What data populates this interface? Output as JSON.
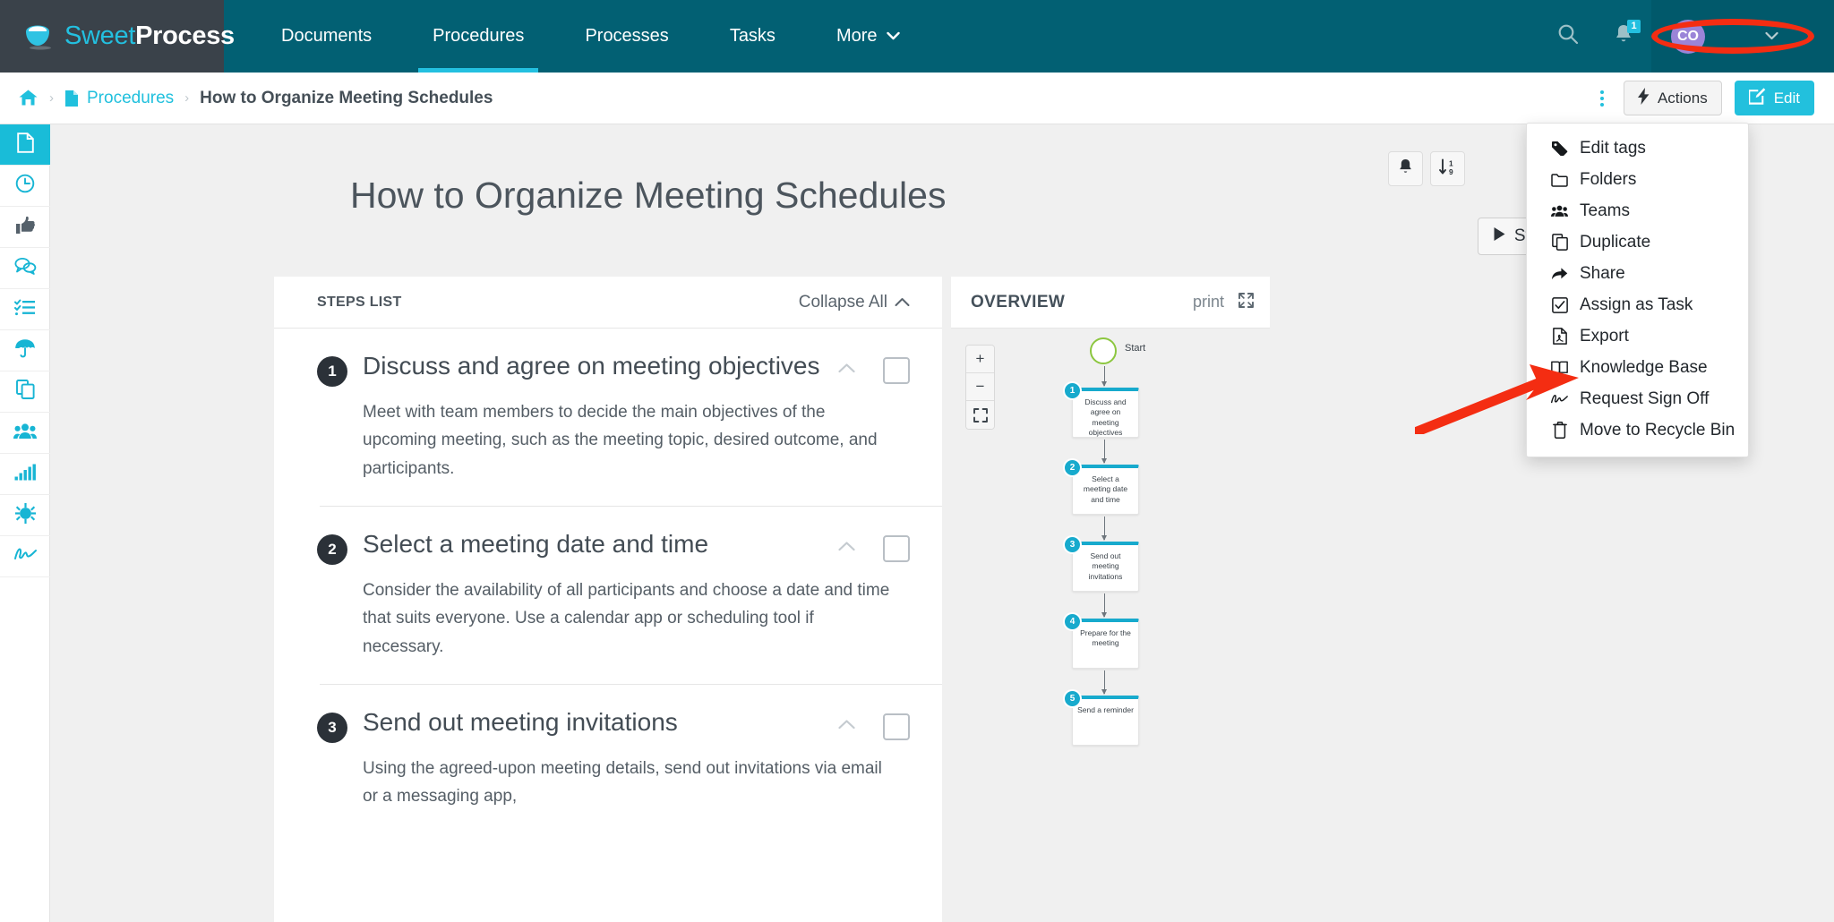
{
  "brand": {
    "name_part1": "Sweet",
    "name_part2": "Process",
    "logo_icon": "coffee-cup-icon"
  },
  "topnav": {
    "items": [
      {
        "label": "Documents",
        "active": false
      },
      {
        "label": "Procedures",
        "active": true
      },
      {
        "label": "Processes",
        "active": false
      },
      {
        "label": "Tasks",
        "active": false
      },
      {
        "label": "More",
        "active": false,
        "caret": "⌄"
      }
    ],
    "search_icon": "search-icon",
    "bell_icon": "bell-icon",
    "notification_count": "1",
    "user": {
      "initials": "CO",
      "name": "         ",
      "caret": "⌄"
    }
  },
  "breadcrumb": {
    "home_icon": "home-icon",
    "sep": "›",
    "doc_icon": "document-icon",
    "parent": "Procedures",
    "current": "How to Organize Meeting Schedules",
    "kebab_icon": "kebab-menu-icon",
    "actions_label": "Actions",
    "actions_icon": "⚡",
    "edit_label": "Edit",
    "edit_icon": "✎"
  },
  "sidebar": {
    "items": [
      {
        "name": "documents",
        "icon": "὜B",
        "glyph": "doc",
        "active": true
      },
      {
        "name": "history",
        "glyph": "clock",
        "active": false
      },
      {
        "name": "approvals",
        "glyph": "thumb",
        "active": false
      },
      {
        "name": "comments",
        "glyph": "chat",
        "active": false
      },
      {
        "name": "checklist",
        "glyph": "list",
        "active": false
      },
      {
        "name": "policies",
        "glyph": "umbrella",
        "active": false
      },
      {
        "name": "copies",
        "glyph": "copy",
        "active": false
      },
      {
        "name": "teams",
        "glyph": "team",
        "active": false
      },
      {
        "name": "reports",
        "glyph": "bars",
        "active": false
      },
      {
        "name": "integrations",
        "glyph": "star",
        "active": false
      },
      {
        "name": "signoff",
        "glyph": "sign",
        "active": false
      }
    ]
  },
  "hero": {
    "title": "How to Organize Meeting Schedules",
    "tools": [
      {
        "name": "notifications-toggle",
        "icon": "bell-icon"
      },
      {
        "name": "sort-toggle",
        "icon": "sort-numeric-icon"
      }
    ],
    "start_label": "Start",
    "start_icon": "play-icon"
  },
  "steps_panel": {
    "header_label": "STEPS LIST",
    "collapse_all_label": "Collapse All",
    "collapse_all_icon": "chevron-up-icon",
    "steps": [
      {
        "number": "1",
        "title": "Discuss and agree on meeting objectives",
        "body": "Meet with team members to decide the main objectives of the upcoming meeting, such as the meeting topic, desired outcome, and participants."
      },
      {
        "number": "2",
        "title": "Select a meeting date and time",
        "body": "Consider the availability of all participants and choose a date and time that suits everyone. Use a calendar app or scheduling tool if necessary."
      },
      {
        "number": "3",
        "title": "Send out meeting invitations",
        "body": "Using the agreed-upon meeting details, send out invitations via email or a messaging app,"
      }
    ]
  },
  "overview_panel": {
    "title": "OVERVIEW",
    "print_label": "print",
    "expand_icon": "expand-icon",
    "zoom_in": "+",
    "zoom_out": "−",
    "zoom_fit": "⛶",
    "flow": {
      "start_label": "Start",
      "nodes": [
        {
          "number": "1",
          "label": "Discuss and agree on meeting objectives"
        },
        {
          "number": "2",
          "label": "Select a meeting date and time"
        },
        {
          "number": "3",
          "label": "Send out meeting invitations"
        },
        {
          "number": "4",
          "label": "Prepare for the meeting"
        },
        {
          "number": "5",
          "label": "Send a reminder"
        }
      ]
    }
  },
  "actions_dropdown": {
    "items": [
      {
        "label": "Edit tags",
        "icon": "tag-icon"
      },
      {
        "label": "Folders",
        "icon": "folder-icon"
      },
      {
        "label": "Teams",
        "icon": "team-icon"
      },
      {
        "label": "Duplicate",
        "icon": "copy-icon"
      },
      {
        "label": "Share",
        "icon": "share-arrow-icon"
      },
      {
        "label": "Assign as Task",
        "icon": "checkbox-icon"
      },
      {
        "label": "Export",
        "icon": "pdf-file-icon"
      },
      {
        "label": "Knowledge Base",
        "icon": "book-icon"
      },
      {
        "label": "Request Sign Off",
        "icon": "signature-icon"
      },
      {
        "label": "Move to Recycle Bin",
        "icon": "trash-icon"
      }
    ]
  },
  "annotations": {
    "arrow_color": "#f42d12",
    "ellipse_color": "#f42d12"
  },
  "colors": {
    "nav_bg": "#026073",
    "brand_bg": "#3a424a",
    "accent": "#22c0dd",
    "page_bg": "#f0f0f0",
    "flow_accent": "#17aacd",
    "start_node": "#8cc63f",
    "avatar": "#9b84d8"
  }
}
